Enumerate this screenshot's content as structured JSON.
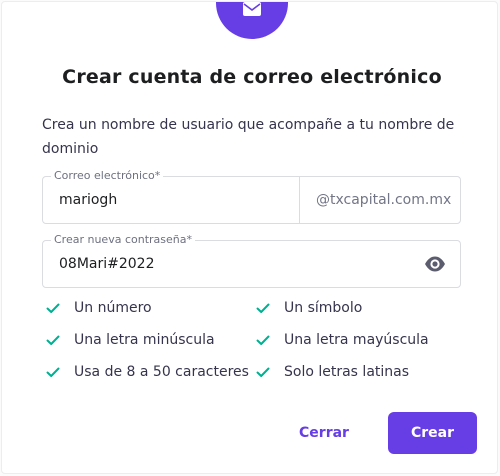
{
  "dialog": {
    "title": "Crear cuenta de correo electrónico",
    "description": "Crea un nombre de usuario que acompañe a tu nombre de dominio"
  },
  "email_field": {
    "label": "Correo electrónico*",
    "value": "mariogh",
    "domain_suffix": "@txcapital.com.mx"
  },
  "password_field": {
    "label": "Crear nueva contraseña*",
    "value": "08Mari#2022",
    "toggle_icon": "eye-icon"
  },
  "password_rules": [
    {
      "label": "Un número",
      "met": true
    },
    {
      "label": "Un símbolo",
      "met": true
    },
    {
      "label": "Una letra minúscula",
      "met": true
    },
    {
      "label": "Una letra mayúscula",
      "met": true
    },
    {
      "label": "Usa de 8 a 50 caracteres",
      "met": true
    },
    {
      "label": "Solo letras latinas",
      "met": true
    }
  ],
  "actions": {
    "close_label": "Cerrar",
    "create_label": "Crear"
  },
  "colors": {
    "accent": "#673de6",
    "check": "#00b090",
    "text": "#1d1e20"
  },
  "header_icon": "mail-icon"
}
